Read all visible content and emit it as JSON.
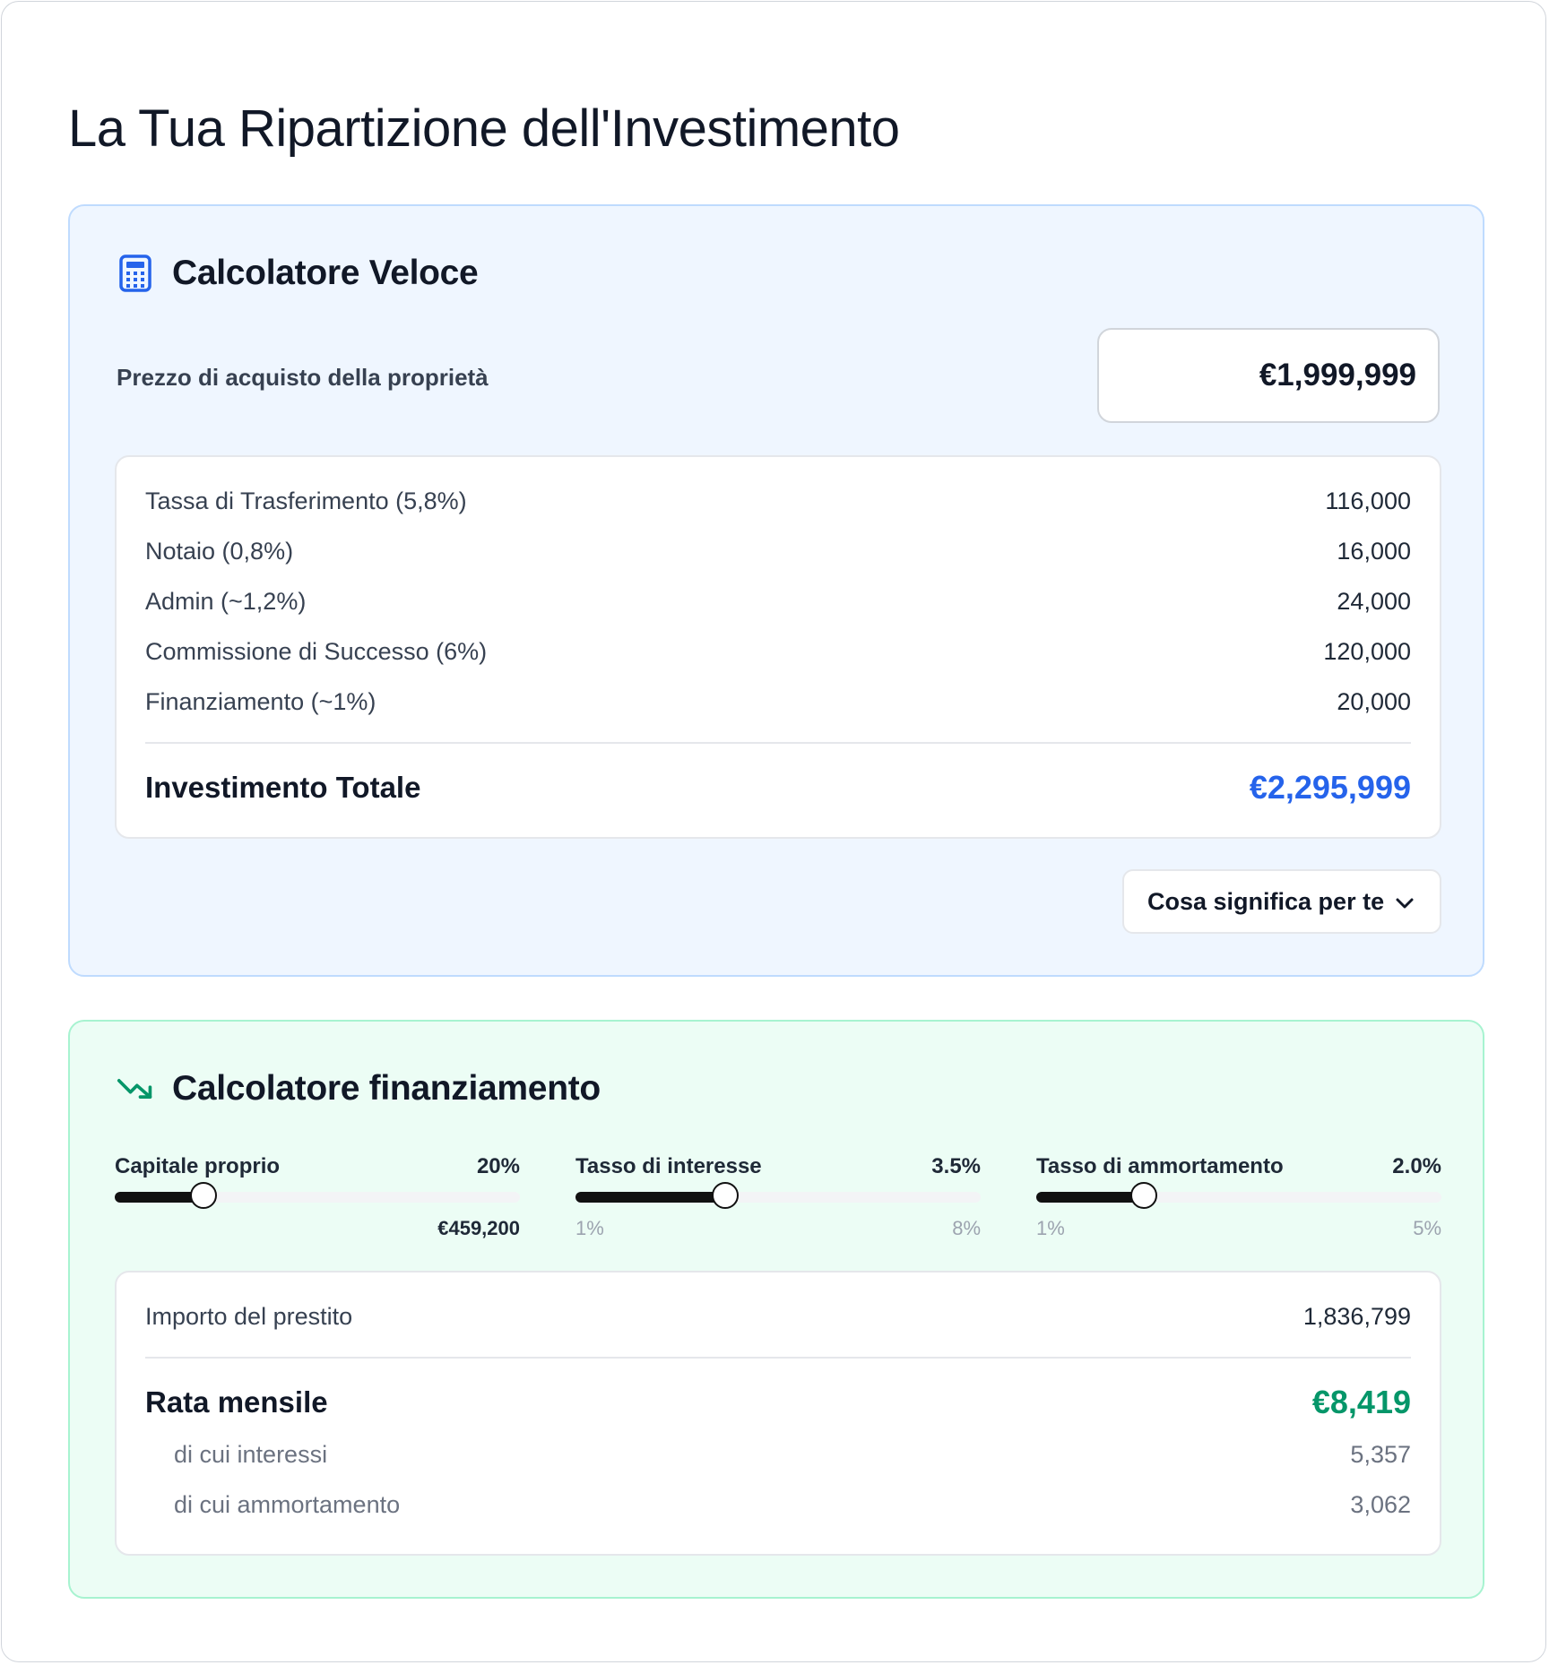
{
  "page": {
    "title": "La Tua Ripartizione dell'Investimento"
  },
  "quick": {
    "title": "Calcolatore Veloce",
    "icon": "calculator-icon",
    "price_label": "Prezzo di acquisto della proprietà",
    "price_value": "€1,999,999",
    "fees": [
      {
        "label": "Tassa di Trasferimento (5,8%)",
        "value": "116,000"
      },
      {
        "label": "Notaio (0,8%)",
        "value": "16,000"
      },
      {
        "label": "Admin (~1,2%)",
        "value": "24,000"
      },
      {
        "label": "Commissione di Successo (6%)",
        "value": "120,000"
      },
      {
        "label": "Finanziamento (~1%)",
        "value": "20,000"
      }
    ],
    "total_label": "Investimento Totale",
    "total_value": "€2,295,999",
    "meaning_button": "Cosa significa per te",
    "accent": "#2563eb"
  },
  "finance": {
    "title": "Calcolatore finanziamento",
    "icon": "trending-down-icon",
    "sliders": [
      {
        "label": "Capitale proprio",
        "value": "20%",
        "fraction": 0.22,
        "sub_right": "€459,200"
      },
      {
        "label": "Tasso di interesse",
        "value": "3.5%",
        "fraction": 0.37,
        "min": "1%",
        "max": "8%"
      },
      {
        "label": "Tasso di ammortamento",
        "value": "2.0%",
        "fraction": 0.265,
        "min": "1%",
        "max": "5%"
      }
    ],
    "loan_label": "Importo del prestito",
    "loan_value": "1,836,799",
    "rate_label": "Rata mensile",
    "rate_value": "€8,419",
    "interest_label": "di cui interessi",
    "interest_value": "5,357",
    "amort_label": "di cui ammortamento",
    "amort_value": "3,062",
    "accent": "#059669"
  }
}
